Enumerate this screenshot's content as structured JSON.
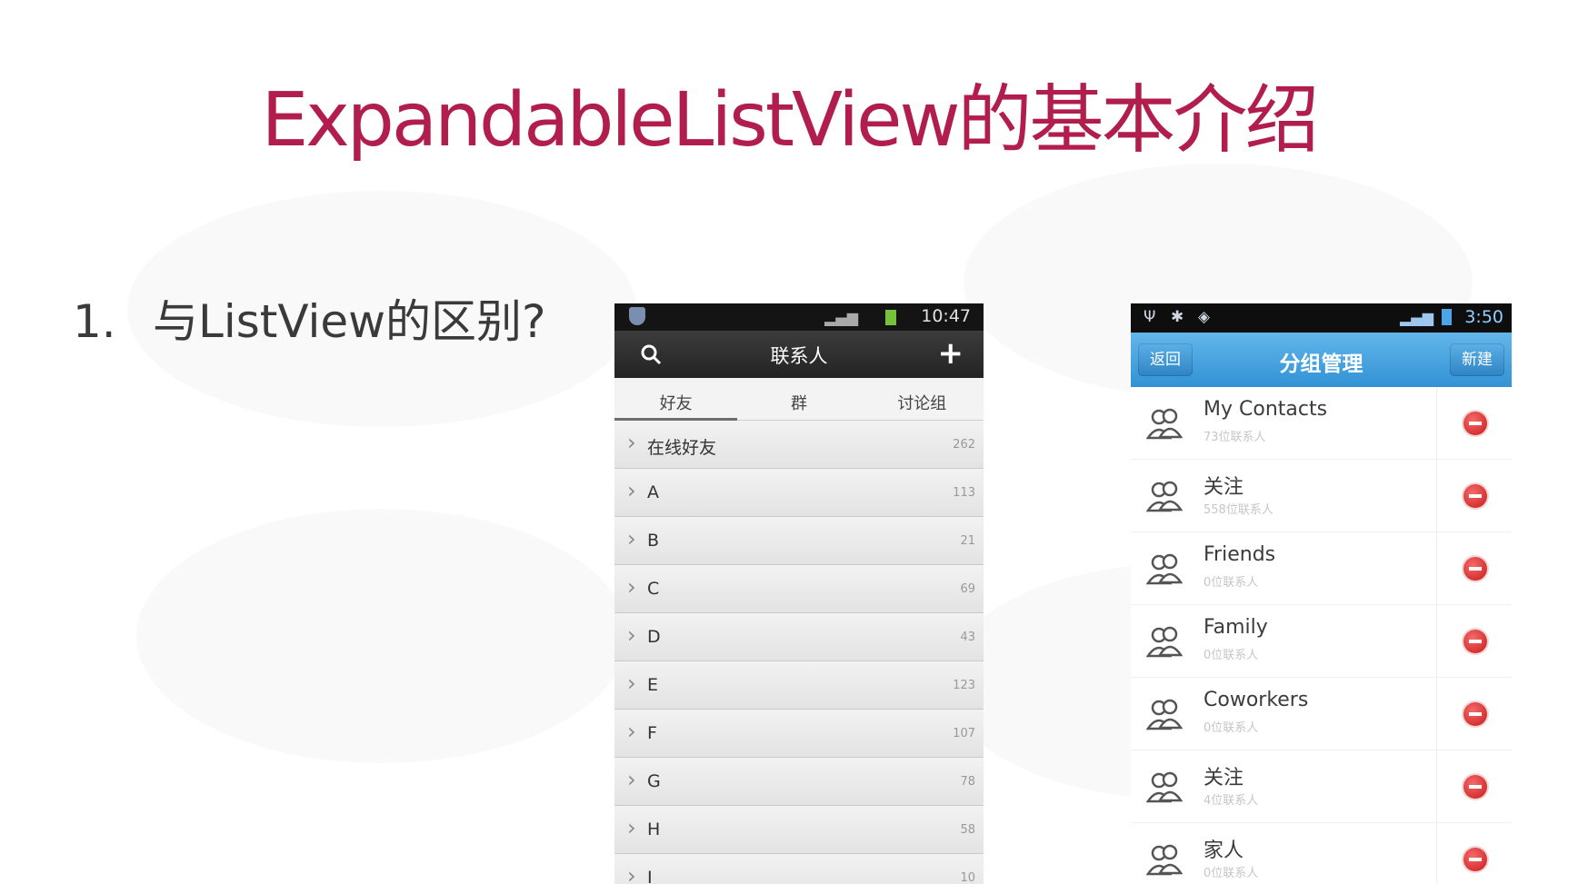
{
  "slide": {
    "title": "ExpandableListView的基本介绍",
    "bullet_number": "1.",
    "bullet_text": "与ListView的区别?"
  },
  "phone1": {
    "status_time": "10:47",
    "header_title": "联系人",
    "add_label": "+",
    "tabs": [
      "好友",
      "群",
      "讨论组"
    ],
    "active_tab": "好友",
    "groups": [
      {
        "name": "在线好友",
        "count": "262"
      },
      {
        "name": "A",
        "count": "113"
      },
      {
        "name": "B",
        "count": "21"
      },
      {
        "name": "C",
        "count": "69"
      },
      {
        "name": "D",
        "count": "43"
      },
      {
        "name": "E",
        "count": "123"
      },
      {
        "name": "F",
        "count": "107"
      },
      {
        "name": "G",
        "count": "78"
      },
      {
        "name": "H",
        "count": "58"
      },
      {
        "name": "I",
        "count": "10"
      }
    ]
  },
  "phone2": {
    "status_time": "3:50",
    "back_label": "返回",
    "header_title": "分组管理",
    "new_label": "新建",
    "groups": [
      {
        "name": "My Contacts",
        "sub": "73位联系人"
      },
      {
        "name": "关注",
        "sub": "558位联系人"
      },
      {
        "name": "Friends",
        "sub": "0位联系人"
      },
      {
        "name": "Family",
        "sub": "0位联系人"
      },
      {
        "name": "Coworkers",
        "sub": "0位联系人"
      },
      {
        "name": "关注",
        "sub": "4位联系人"
      },
      {
        "name": "家人",
        "sub": "0位联系人"
      }
    ]
  },
  "colors": {
    "title": "#b11d4d",
    "bullet": "#3a3a3a",
    "phone2_header": "#3192d5",
    "delete_button": "#c81a1a"
  },
  "icons": {
    "search": "search-icon",
    "chevron": "chevron-right-icon",
    "avatar": "group-people-icon",
    "delete": "delete-minus-icon"
  }
}
